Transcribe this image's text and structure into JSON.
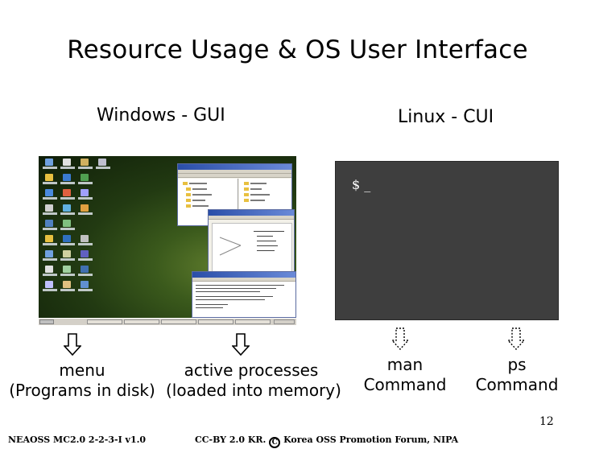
{
  "slide": {
    "title": "Resource Usage & OS User Interface",
    "left_heading": "Windows - GUI",
    "right_heading": "Linux - CUI"
  },
  "terminal": {
    "prompt": "$ _"
  },
  "labels": {
    "menu_line1": "menu",
    "menu_line2": "(Programs in disk)",
    "active_line1": "active processes",
    "active_line2": "(loaded into memory)",
    "man_line1": "man",
    "man_line2": "Command",
    "ps_line1": "ps",
    "ps_line2": "Command"
  },
  "footer": {
    "page_number": "12",
    "left": "NEAOSS MC2.0 2-2-3-I v1.0",
    "right_prefix": "CC-BY 2.0 KR.",
    "copyright_symbol": "C",
    "right_suffix": "Korea OSS Promotion Forum, NIPA"
  }
}
